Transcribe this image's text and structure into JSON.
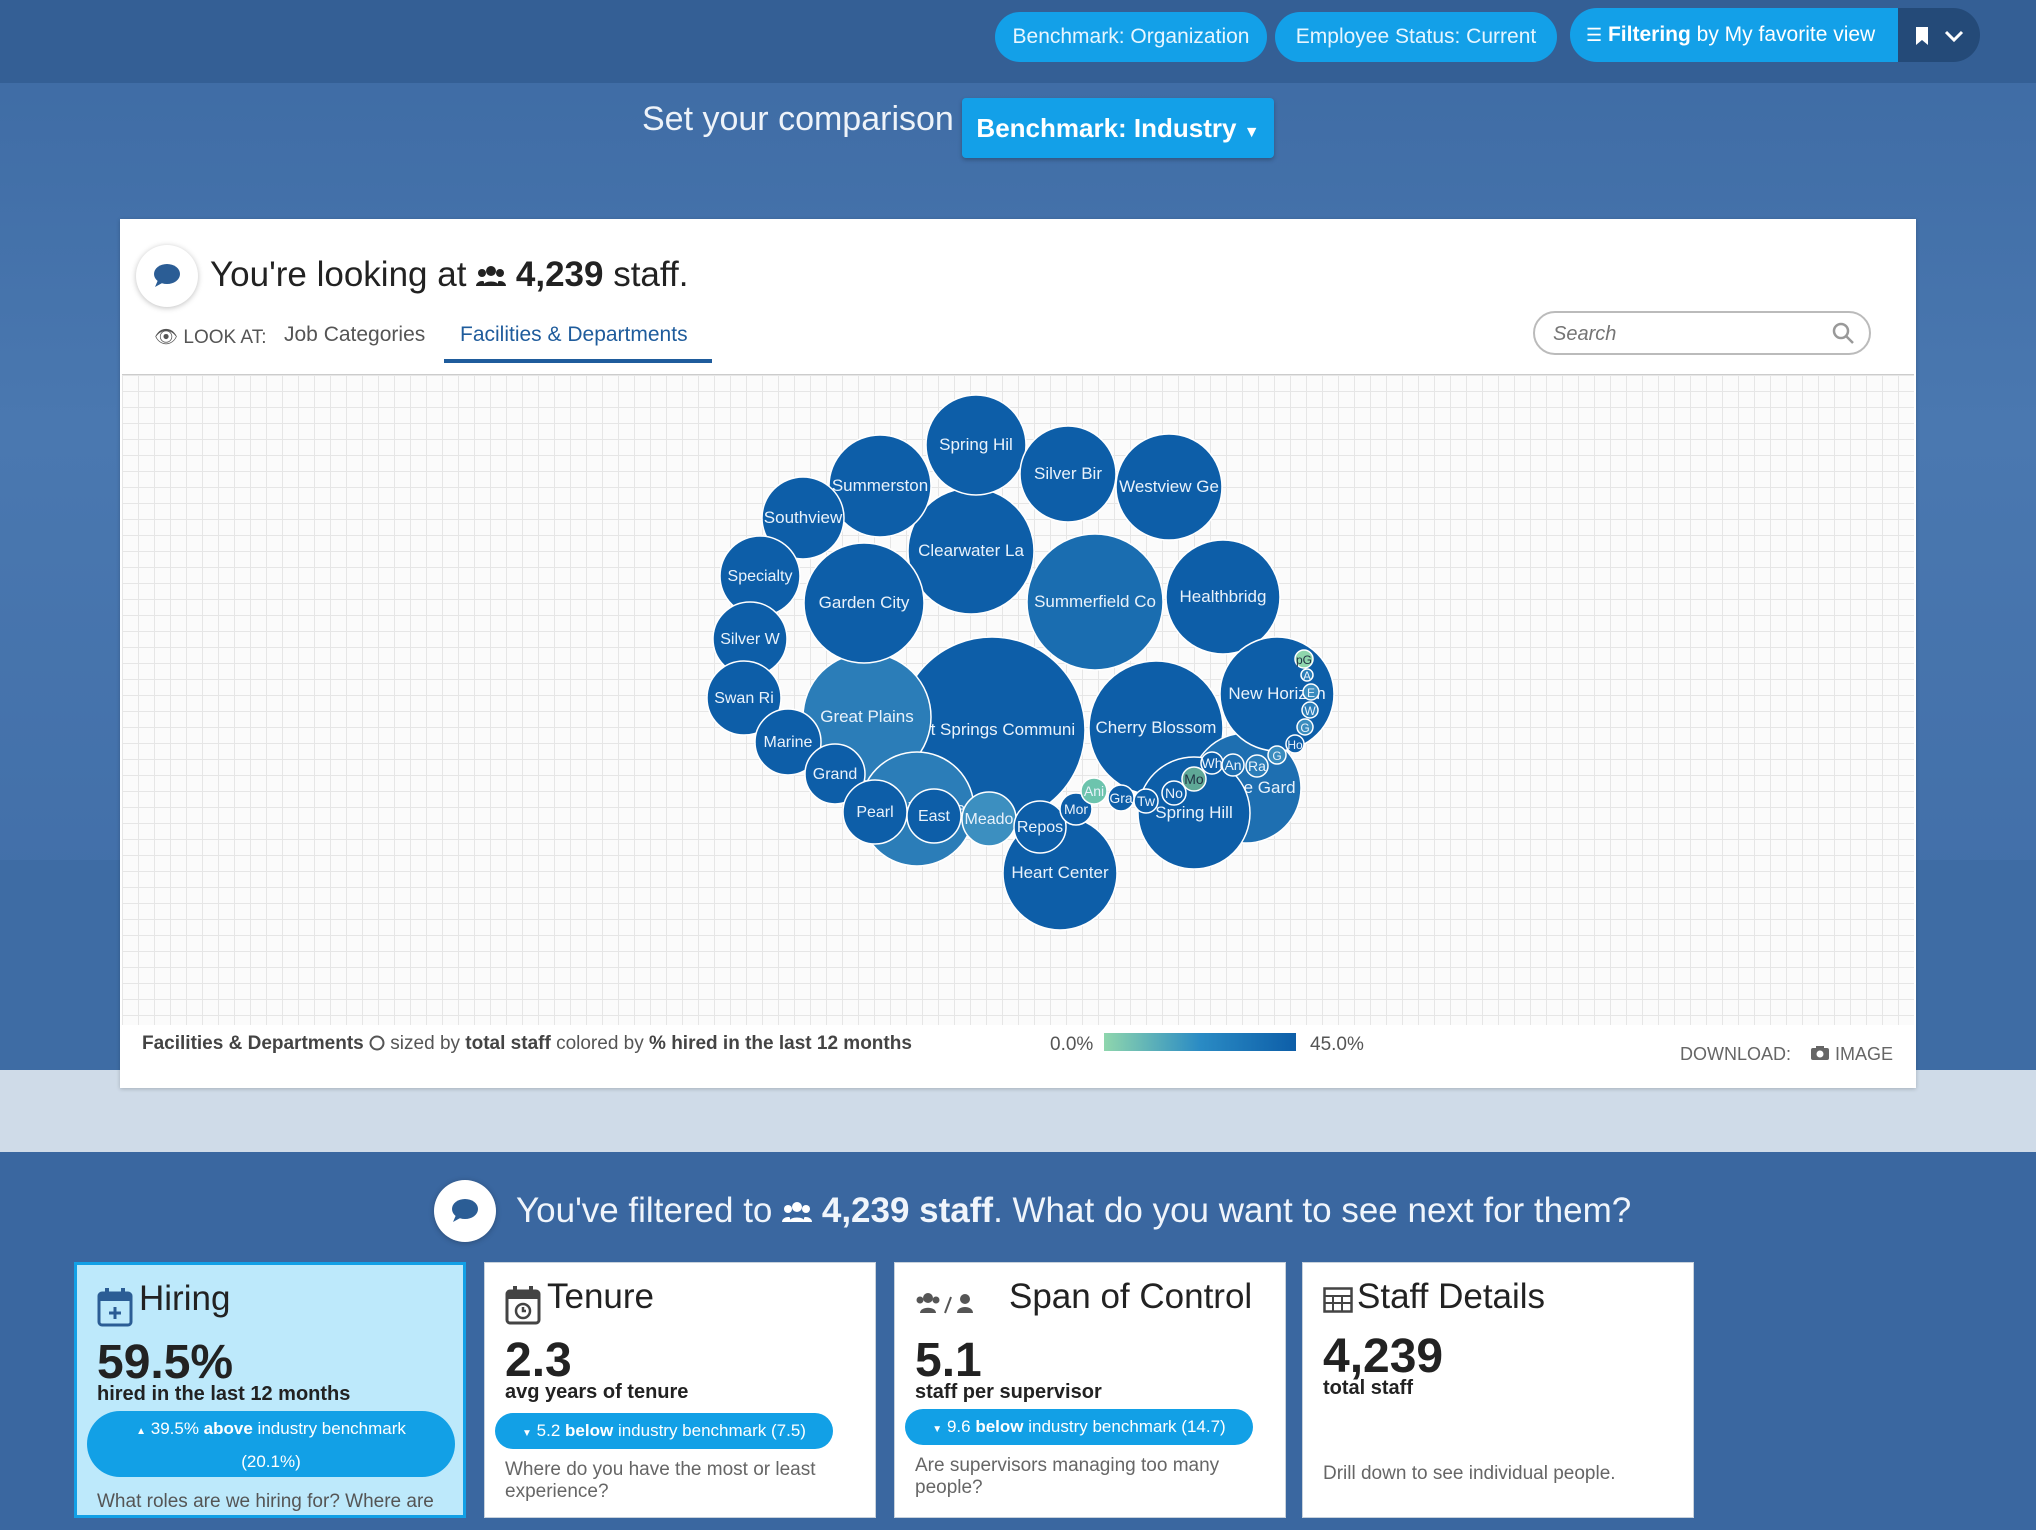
{
  "topbar": {
    "benchmark_pill": "Benchmark: Organization",
    "status_pill": "Employee Status: Current",
    "view_prefix": "Filtering",
    "view_rest": " by My favorite view"
  },
  "comparison": {
    "label": "Set your comparison",
    "button": "Benchmark: Industry"
  },
  "card": {
    "headline_pre": "You're looking at ",
    "staff_count": "4,239",
    "headline_post": " staff.",
    "look_at": "LOOK AT:",
    "tabs": [
      "Job Categories",
      "Facilities & Departments"
    ],
    "search_placeholder": "Search"
  },
  "chart_data": {
    "type": "bubble",
    "size_by": "total staff",
    "color_by": "% hired in the last 12 months",
    "color_range": [
      "0.0%",
      "45.0%"
    ],
    "bubbles": [
      {
        "label": "Hot Springs Communi",
        "size": 1.0
      },
      {
        "label": "Summerfield Co",
        "size": 0.55
      },
      {
        "label": "Cherry Blossom",
        "size": 0.53
      },
      {
        "label": "Great Plains",
        "size": 0.49
      },
      {
        "label": "Clearwater La",
        "size": 0.48
      },
      {
        "label": "Orange Gard",
        "size": 0.43
      },
      {
        "label": "Heart Center",
        "size": 0.43
      },
      {
        "label": "Spring Hill",
        "size": 0.43
      },
      {
        "label": "Specialty Ge",
        "size": 0.44
      },
      {
        "label": "Healthbridg",
        "size": 0.44
      },
      {
        "label": "New Horizon",
        "size": 0.44
      },
      {
        "label": "Garden City",
        "size": 0.46
      },
      {
        "label": "Westview Ge",
        "size": 0.4
      },
      {
        "label": "Summerston",
        "size": 0.39
      },
      {
        "label": "Spring Hil",
        "size": 0.38
      },
      {
        "label": "Silver Bir",
        "size": 0.37
      },
      {
        "label": "Southview",
        "size": 0.3
      },
      {
        "label": "Specialty",
        "size": 0.3
      },
      {
        "label": "Silver W",
        "size": 0.28
      },
      {
        "label": "Swan Ri",
        "size": 0.28
      },
      {
        "label": "Marine",
        "size": 0.25
      },
      {
        "label": "Grand",
        "size": 0.23
      },
      {
        "label": "Pearl",
        "size": 0.25
      },
      {
        "label": "East",
        "size": 0.21
      },
      {
        "label": "Meado",
        "size": 0.2
      },
      {
        "label": "Repos",
        "size": 0.2
      },
      {
        "label": "Mor",
        "size": 0.12
      },
      {
        "label": "Ani",
        "size": 0.1
      },
      {
        "label": "Gra",
        "size": 0.1
      },
      {
        "label": "Tw",
        "size": 0.09
      },
      {
        "label": "No",
        "size": 0.09
      },
      {
        "label": "Mo",
        "size": 0.09
      },
      {
        "label": "Wh",
        "size": 0.08
      },
      {
        "label": "An",
        "size": 0.08
      },
      {
        "label": "Ra",
        "size": 0.08
      },
      {
        "label": "G",
        "size": 0.06
      },
      {
        "label": "Ho",
        "size": 0.06
      },
      {
        "label": "G",
        "size": 0.05
      },
      {
        "label": "W",
        "size": 0.05
      },
      {
        "label": "E",
        "size": 0.05
      },
      {
        "label": "A",
        "size": 0.04
      },
      {
        "label": "pG",
        "size": 0.06
      }
    ]
  },
  "legend": {
    "dim": "Facilities & Departments",
    "sized_by_pre": " sized by ",
    "sized_by": "total staff",
    "colored_by_pre": " colored by ",
    "colored_by": "% hired in the last 12 months",
    "lo": "0.0%",
    "hi": "45.0%"
  },
  "download": {
    "label": "DOWNLOAD:",
    "image": "IMAGE"
  },
  "filtered": {
    "pre": "You've filtered to ",
    "count": "4,239 staff",
    "post": ". What do you want to see next for them?"
  },
  "cards": {
    "hiring": {
      "title": "Hiring",
      "value": "59.5%",
      "sub": "hired in the last 12 months",
      "bench_amount": "39.5%",
      "bench_dir": "above",
      "bench_text": "industry benchmark",
      "bench_ref": "(20.1%)",
      "desc": "What roles are we hiring for? Where are"
    },
    "tenure": {
      "title": "Tenure",
      "value": "2.3",
      "sub": "avg years of tenure",
      "bench_amount": "5.2",
      "bench_dir": "below",
      "bench_text": "industry benchmark (7.5)",
      "desc": "Where do you have the most or least experience?"
    },
    "span": {
      "title": "Span of Control",
      "value": "5.1",
      "sub": "staff per supervisor",
      "bench_amount": "9.6",
      "bench_dir": "below",
      "bench_text": "industry benchmark (14.7)",
      "desc": "Are supervisors managing too many people?"
    },
    "details": {
      "title": "Staff Details",
      "value": "4,239",
      "sub": "total staff",
      "desc": "Drill down to see individual people."
    }
  }
}
